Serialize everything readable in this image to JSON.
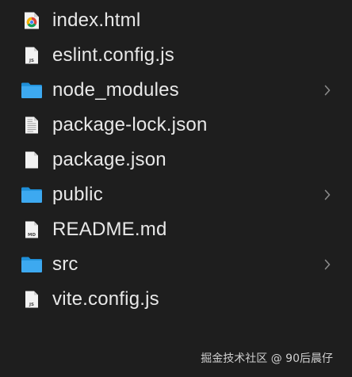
{
  "file_browser": {
    "items": [
      {
        "name": "index.html",
        "icon": "chrome-html-file-icon",
        "kind": "file"
      },
      {
        "name": "eslint.config.js",
        "icon": "js-file-icon",
        "kind": "file",
        "badge": "JS"
      },
      {
        "name": "node_modules",
        "icon": "folder-icon",
        "kind": "folder"
      },
      {
        "name": "package-lock.json",
        "icon": "text-file-icon",
        "kind": "file"
      },
      {
        "name": "package.json",
        "icon": "blank-file-icon",
        "kind": "file"
      },
      {
        "name": "public",
        "icon": "folder-icon",
        "kind": "folder"
      },
      {
        "name": "README.md",
        "icon": "md-file-icon",
        "kind": "file",
        "badge": "MD"
      },
      {
        "name": "src",
        "icon": "folder-icon",
        "kind": "folder"
      },
      {
        "name": "vite.config.js",
        "icon": "js-file-icon",
        "kind": "file",
        "badge": "JS"
      }
    ]
  },
  "watermark": "掘金技术社区 @ 90后晨仔",
  "colors": {
    "background": "#1e1e1e",
    "folder": "#3da9f0",
    "text": "#e8e8e8",
    "chevron": "#8a8a8a"
  }
}
